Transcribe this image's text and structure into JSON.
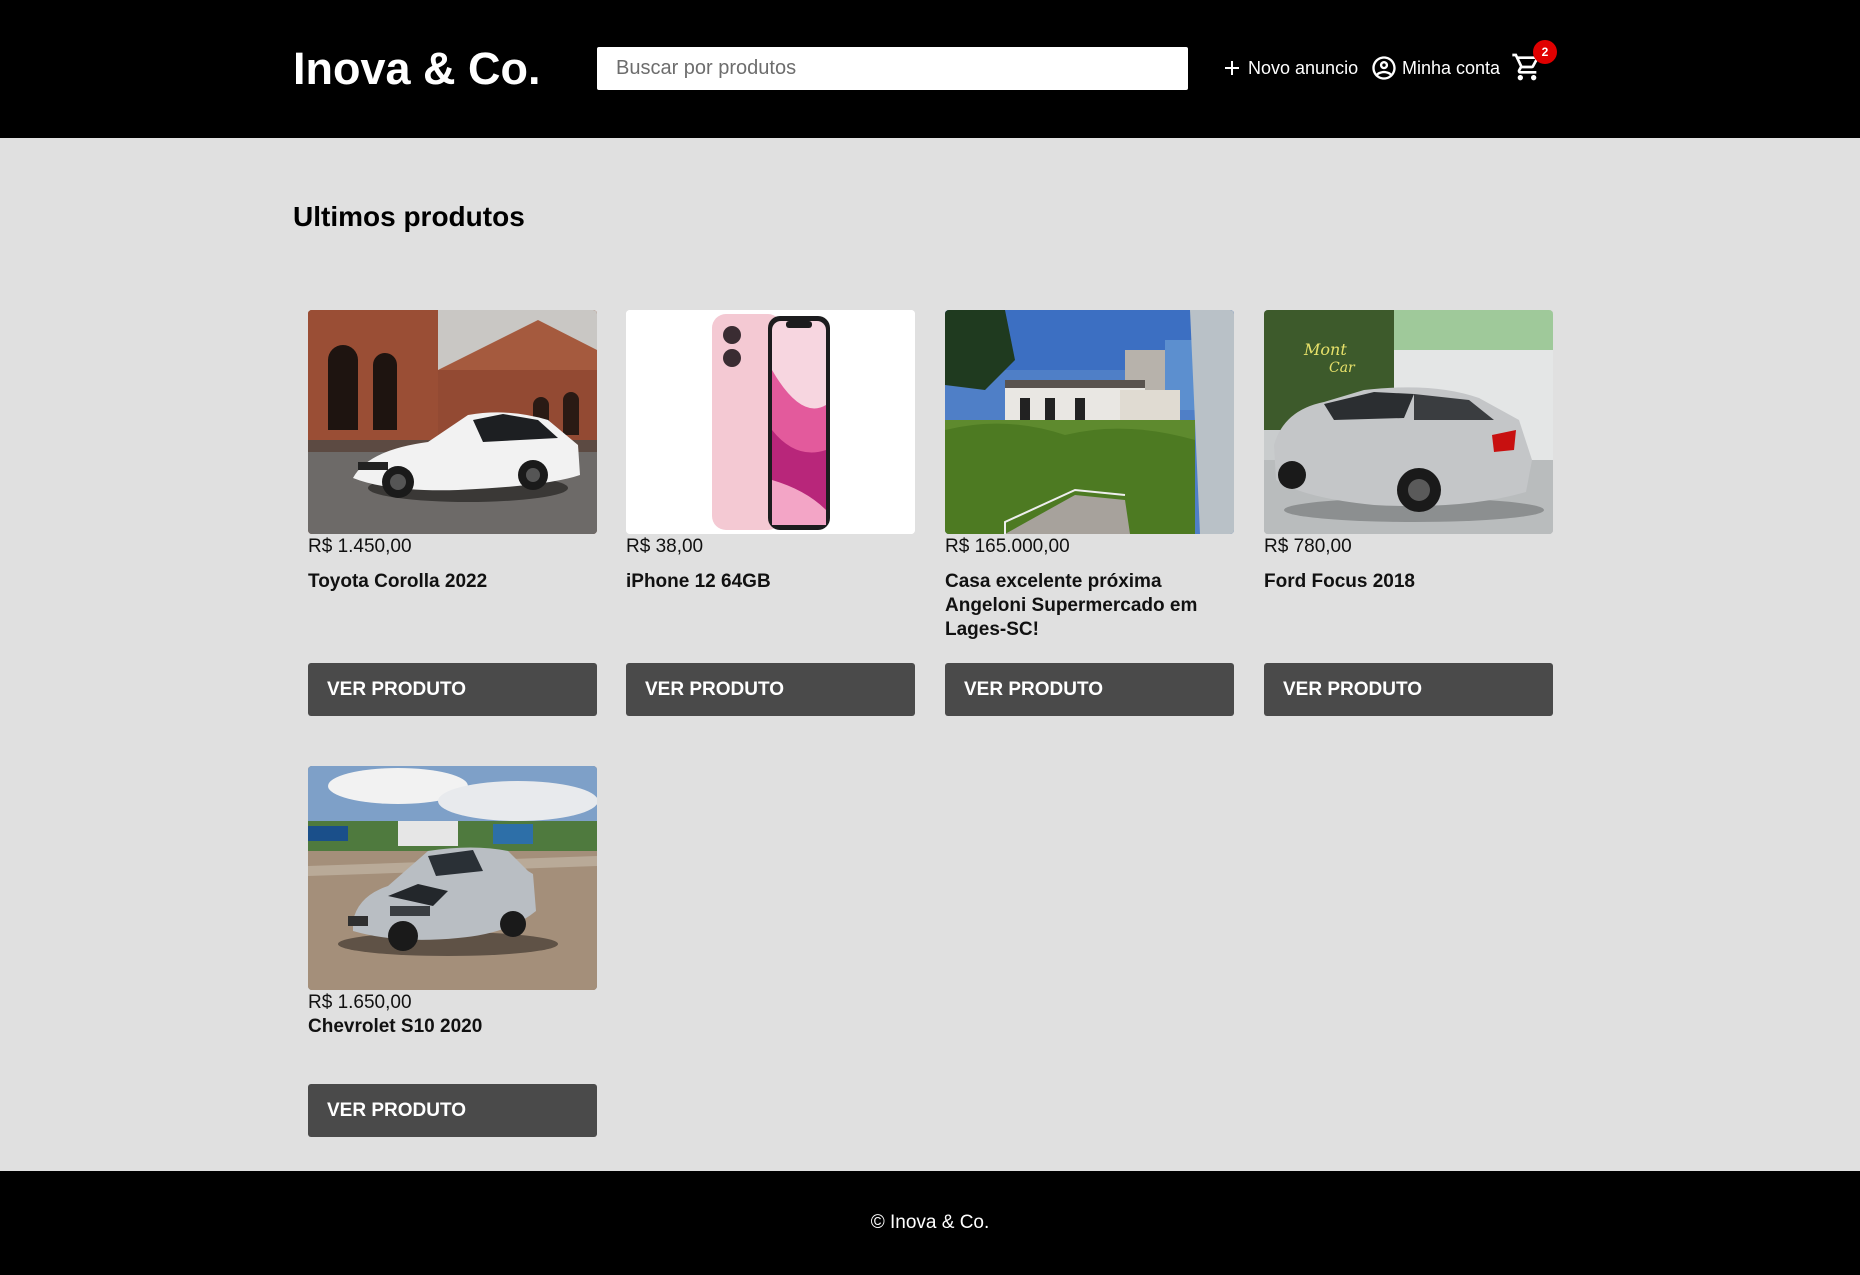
{
  "header": {
    "logo": "Inova & Co.",
    "search_placeholder": "Buscar por produtos",
    "search_value": "",
    "new_listing_label": "Novo anuncio",
    "account_label": "Minha conta",
    "cart_count": "2",
    "icons": [
      "plus-icon",
      "account-circle-icon",
      "cart-icon"
    ]
  },
  "main": {
    "title": "Ultimos produtos",
    "products": [
      {
        "price": "R$ 1.450,00",
        "title": "Toyota Corolla 2022",
        "button": "VER PRODUTO",
        "image": "white sedan in front of brick building"
      },
      {
        "price": "R$ 38,00",
        "title": "iPhone 12 64GB",
        "button": "VER PRODUTO",
        "image": "pink smartphone"
      },
      {
        "price": "R$ 165.000,00",
        "title": "Casa excelente próxima Angeloni Supermercado em Lages-SC!",
        "button": "VER PRODUTO",
        "image": "house with green yard"
      },
      {
        "price": "R$ 780,00",
        "title": "Ford Focus 2018",
        "button": "VER PRODUTO",
        "image": "silver sedan in garage"
      },
      {
        "price": "R$ 1.650,00",
        "title": "Chevrolet S10 2020",
        "button": "VER PRODUTO",
        "image": "silver pickup truck on paved street"
      }
    ]
  },
  "footer": {
    "text": "© Inova & Co."
  },
  "colors": {
    "header_bg": "#000000",
    "page_bg": "#e0e0e0",
    "button_bg": "#4a4a4a",
    "badge": "#e00000"
  }
}
